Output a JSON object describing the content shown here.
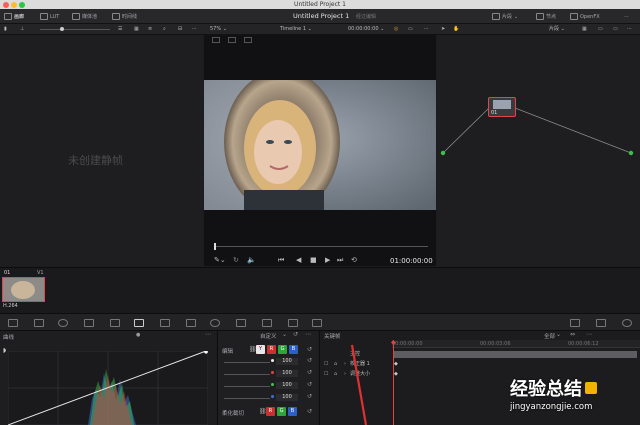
{
  "window": {
    "title": "Untitled Project 1"
  },
  "topbar": {
    "tabs": [
      {
        "label": "画廊",
        "icon": "gallery-icon"
      },
      {
        "label": "LUT",
        "icon": "lut-icon"
      },
      {
        "label": "媒体池",
        "icon": "media-pool-icon"
      },
      {
        "label": "时间线",
        "icon": "timeline-icon"
      }
    ],
    "project_title": "Untitled Project 1",
    "project_status": "经过编辑",
    "right_tabs": [
      {
        "label": "片段",
        "icon": "clip-icon"
      },
      {
        "label": "节点",
        "icon": "nodes-icon"
      },
      {
        "label": "OpenFX",
        "icon": "openfx-icon"
      }
    ]
  },
  "toolbar": {
    "zoom": "57%",
    "timeline_name": "Timeline 1",
    "timecode": "00:00:00:00",
    "node_mode": "片段"
  },
  "gallery": {
    "empty_text": "未创建静帧"
  },
  "viewer": {
    "timecode": "01:00:00:00"
  },
  "nodes": {
    "node_label": "01"
  },
  "clips": {
    "clip_number": "01",
    "track": "V1",
    "codec": "H.264"
  },
  "curves": {
    "title": "曲线"
  },
  "edit": {
    "title": "编辑",
    "custom_label": "自定义",
    "channels": [
      {
        "value": "100",
        "color": "#eeeeee"
      },
      {
        "value": "100",
        "color": "#e84040"
      },
      {
        "value": "100",
        "color": "#3cc84a"
      },
      {
        "value": "100",
        "color": "#3b6fe0"
      }
    ],
    "soft_clip": "柔化截切",
    "channel_buttons": [
      "Y",
      "R",
      "G",
      "B"
    ]
  },
  "keyframes": {
    "title": "关键帧",
    "filter": "全部",
    "ruler": [
      "00:00:00:00",
      "00:00:03:06",
      "00:00:06:12"
    ],
    "rows": [
      "主控",
      "校正器 1",
      "调整大小"
    ]
  },
  "watermark": {
    "main": "经验总结",
    "url": "jingyanzongjie.com"
  }
}
